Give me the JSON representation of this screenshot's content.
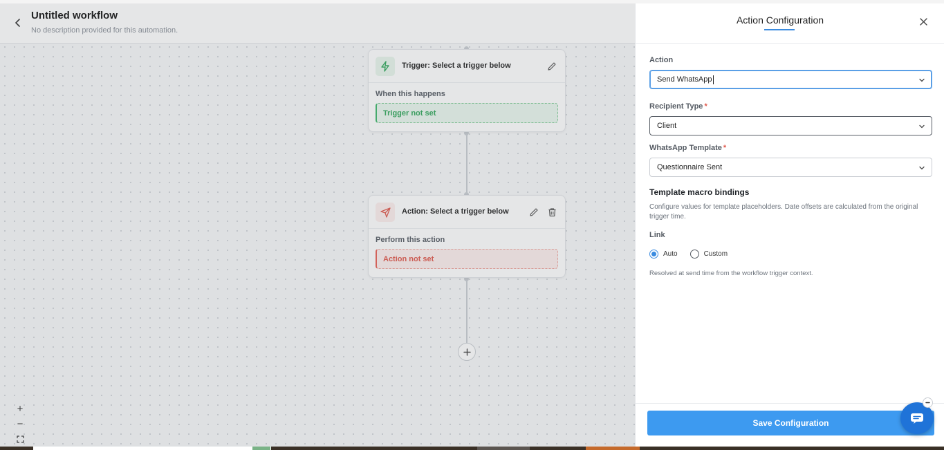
{
  "workflow": {
    "title": "Untitled workflow",
    "description": "No description provided for this automation.",
    "trigger_node": {
      "title": "Trigger: Select a trigger below",
      "subtitle": "When this happens",
      "status": "Trigger not set"
    },
    "action_node": {
      "title": "Action: Select a trigger below",
      "subtitle": "Perform this action",
      "status": "Action not set"
    },
    "zoom": {
      "in": "+",
      "out": "−"
    }
  },
  "panel": {
    "title": "Action Configuration",
    "action": {
      "label": "Action",
      "value": "Send WhatsApp"
    },
    "recipient": {
      "label": "Recipient Type",
      "required": "*",
      "value": "Client"
    },
    "template": {
      "label": "WhatsApp Template",
      "required": "*",
      "value": "Questionnaire Sent"
    },
    "macro": {
      "title": "Template macro bindings",
      "description": "Configure values for template placeholders. Date offsets are calculated from the original trigger time."
    },
    "link": {
      "label": "Link",
      "options": [
        "Auto",
        "Custom"
      ],
      "selected": "Auto",
      "help": "Resolved at send time from the workflow trigger context."
    },
    "save_label": "Save Configuration"
  },
  "colors": {
    "accent": "#3d9af0",
    "success": "#2fa65a",
    "danger": "#e0574b",
    "chat": "#1f73d8"
  }
}
